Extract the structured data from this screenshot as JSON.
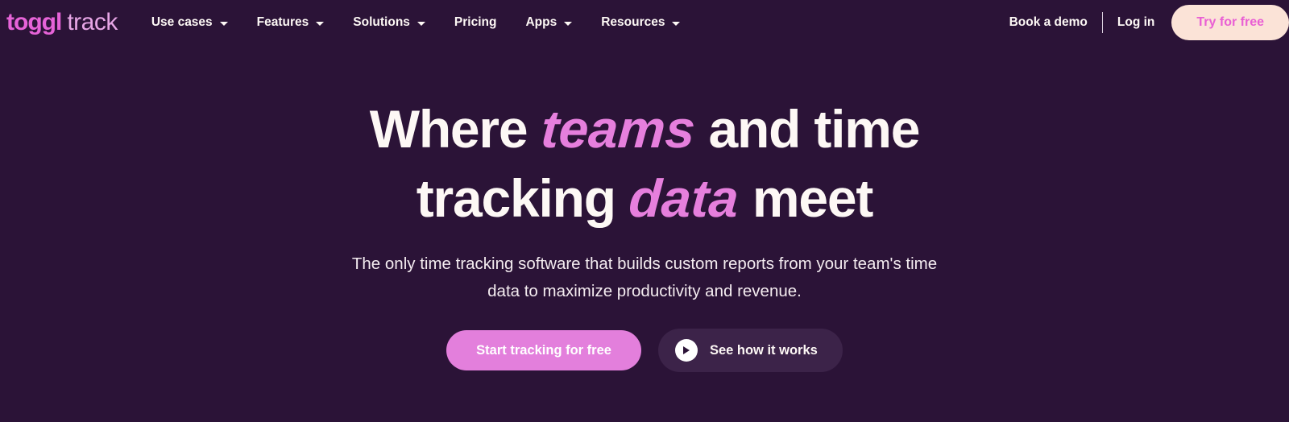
{
  "colors": {
    "background": "#2b1337",
    "accent_pink": "#e67fdd",
    "logo_pink": "#e663d8",
    "logo_track_pink": "#e7a6e6",
    "cream": "#fbe3d7",
    "text_light": "#fdf8f5",
    "secondary_button_bg": "#3c2349"
  },
  "header": {
    "logo": {
      "brand": "toggl",
      "product": "track"
    },
    "nav": [
      {
        "label": "Use cases",
        "has_dropdown": true,
        "icon": "chevron-down-icon"
      },
      {
        "label": "Features",
        "has_dropdown": true,
        "icon": "chevron-down-icon"
      },
      {
        "label": "Solutions",
        "has_dropdown": true,
        "icon": "chevron-down-icon"
      },
      {
        "label": "Pricing",
        "has_dropdown": false,
        "icon": ""
      },
      {
        "label": "Apps",
        "has_dropdown": true,
        "icon": "chevron-down-icon"
      },
      {
        "label": "Resources",
        "has_dropdown": true,
        "icon": "chevron-down-icon"
      }
    ],
    "book_demo_label": "Book a demo",
    "login_label": "Log in",
    "try_free_label": "Try for free"
  },
  "hero": {
    "headline": {
      "line1_part1": "Where ",
      "line1_accent": "teams",
      "line1_part2": " and time",
      "line2_part1": "tracking ",
      "line2_accent": "data",
      "line2_part2": " meet"
    },
    "subheading": "The only time tracking software that builds custom reports from your team's time data to maximize productivity and revenue.",
    "primary_cta": "Start tracking for free",
    "secondary_cta": "See how it works",
    "secondary_cta_icon": "play-circle-icon"
  }
}
